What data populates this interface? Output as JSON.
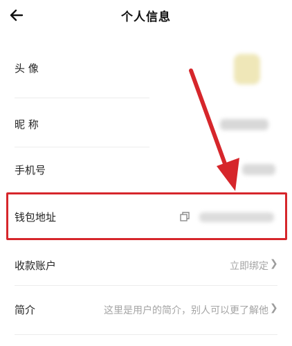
{
  "header": {
    "title": "个人信息"
  },
  "rows": {
    "avatar": {
      "label": "头 像"
    },
    "nickname": {
      "label": "昵 称"
    },
    "phone": {
      "label": "手机号"
    },
    "wallet": {
      "label": "钱包地址"
    },
    "payment": {
      "label": "收款账户",
      "action": "立即绑定"
    },
    "bio": {
      "label": "简介",
      "value": "这里是用户的简介，别人可以更了解他"
    }
  },
  "colors": {
    "highlight": "#d6262b",
    "arrow": "#d6262b"
  }
}
